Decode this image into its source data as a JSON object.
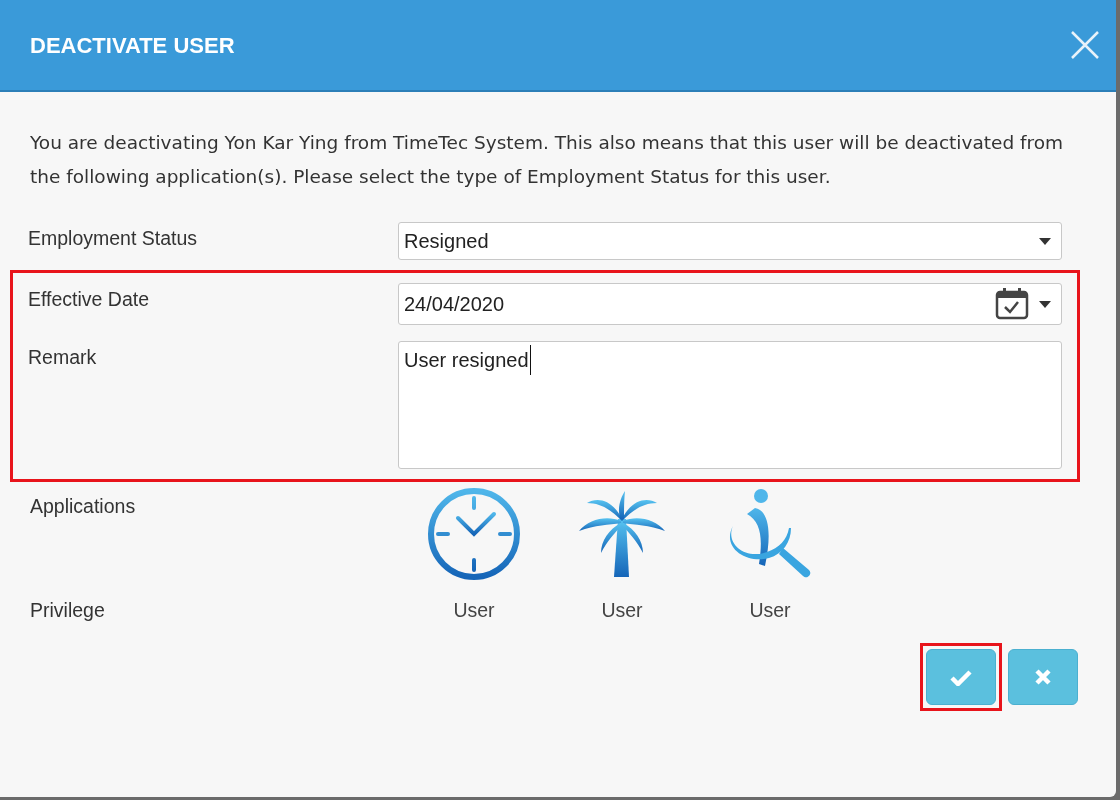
{
  "dialog": {
    "title": "DEACTIVATE USER",
    "message": "You are deactivating Yon Kar Ying from TimeTec System. This also means that this user will be deactivated from the following application(s). Please select the type of Employment Status for this user."
  },
  "fields": [
    {
      "kind": "select",
      "label": "Employment Status",
      "value": "Resigned",
      "highlighted": false
    },
    {
      "kind": "date",
      "label": "Effective Date",
      "value": "24/04/2020",
      "highlighted": true
    },
    {
      "kind": "textarea",
      "label": "Remark",
      "value": "User resigned",
      "highlighted": true
    }
  ],
  "applications": {
    "label": "Applications",
    "privilege_label": "Privilege",
    "items": [
      {
        "kind": "clock",
        "privilege": "User"
      },
      {
        "kind": "palm",
        "privilege": "User"
      },
      {
        "kind": "person",
        "privilege": "User"
      }
    ]
  },
  "buttons": [
    {
      "kind": "confirm",
      "highlighted": true
    },
    {
      "kind": "cancel",
      "highlighted": false
    }
  ]
}
